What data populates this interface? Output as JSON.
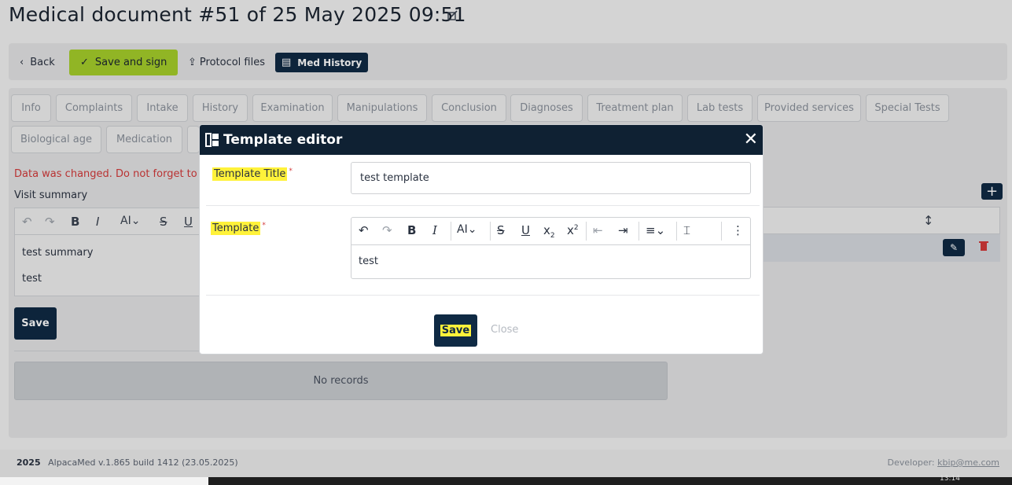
{
  "page": {
    "title": "Medical document #51 of 25 May 2025 09:51",
    "edit_icon": "pencil-square-icon"
  },
  "toolbar": {
    "back_label": "Back",
    "save_sign_label": "Save and sign",
    "protocol_files_label": "Protocol files",
    "med_history_label": "Med History"
  },
  "tabs": [
    "Info",
    "Complaints",
    "Intake",
    "History",
    "Examination",
    "Manipulations",
    "Conclusion",
    "Diagnoses",
    "Treatment plan",
    "Lab tests",
    "Provided services",
    "Special Tests",
    "Biological age",
    "Medication"
  ],
  "background": {
    "warning": "Data was changed. Do not forget to sa",
    "visit_summary_label": "Visit summary",
    "editor_lines": [
      "test summary",
      "test"
    ],
    "save_label": "Save",
    "no_records": "No records"
  },
  "modal": {
    "title": "Template editor",
    "title_field_label": "Template Title",
    "title_field_value": "test template",
    "template_field_label": "Template",
    "template_body": "test",
    "save_label": "Save",
    "close_label": "Close",
    "required_mark": "*"
  },
  "footer": {
    "year": "2025",
    "version": "AlpacaMed v.1.865 build 1412 (23.05.2025)",
    "developer_label": "Developer:",
    "developer_email": "kbip@me.com"
  },
  "taskbar": {
    "time": "13:14"
  },
  "colors": {
    "primary": "#0f2a44",
    "accent_green": "#a6cf2b",
    "highlight": "#fff23a",
    "danger": "#d33a3a"
  }
}
